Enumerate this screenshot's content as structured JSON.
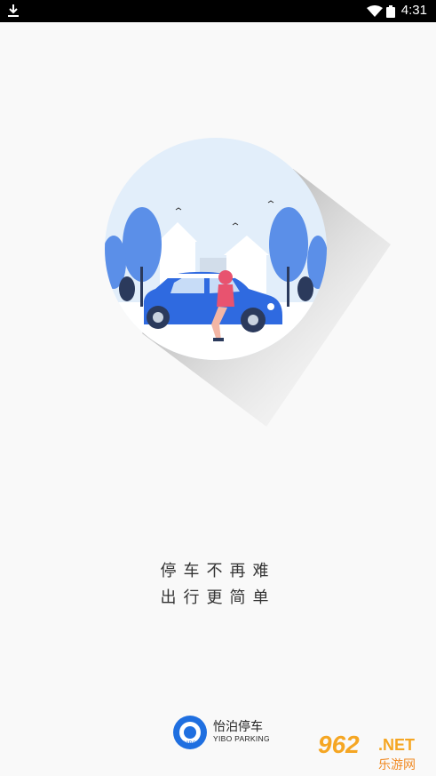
{
  "status_bar": {
    "time": "4:31",
    "download_icon": "download-icon",
    "wifi_icon": "wifi-icon",
    "battery_icon": "battery-icon"
  },
  "illustration": {
    "subject": "parking-car-illustration"
  },
  "slogan": {
    "line1": "停车不再难",
    "line2": "出行更简单"
  },
  "brand": {
    "name": "怡泊停车",
    "name_en": "YIBO PARKING",
    "logo_text": "YIBO"
  },
  "watermark": {
    "number": "962",
    "suffix": ".NET",
    "cn": "乐游网"
  },
  "colors": {
    "accent_blue": "#3a6fd8",
    "background": "#f9f9f9",
    "watermark_orange": "#f5a623"
  }
}
